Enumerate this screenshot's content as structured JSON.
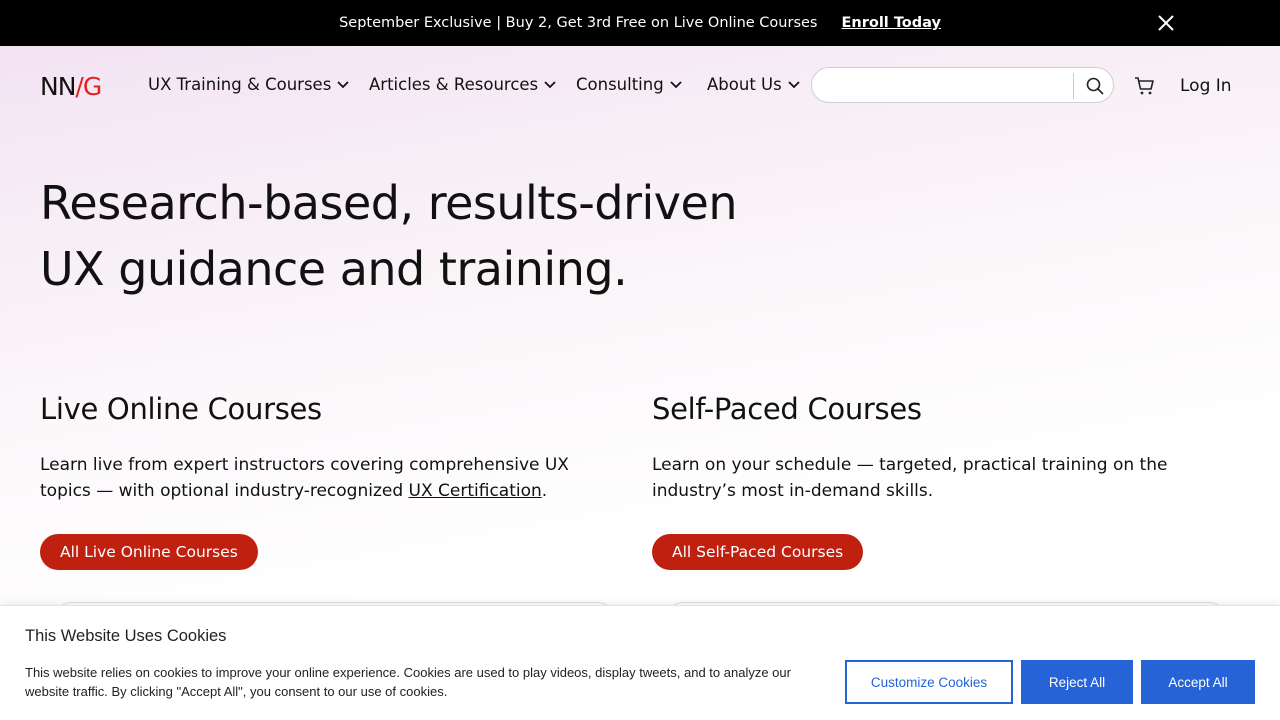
{
  "promo": {
    "text": "September Exclusive | Buy 2, Get 3rd Free on Live Online Courses",
    "link": "Enroll Today"
  },
  "nav": {
    "logo": {
      "part1": "NN",
      "slash": "/",
      "part2": "G"
    },
    "items": [
      {
        "label": "UX Training & Courses"
      },
      {
        "label": "Articles & Resources"
      },
      {
        "label": "Consulting"
      },
      {
        "label": "About Us"
      }
    ],
    "search_value": "",
    "login": "Log In"
  },
  "hero": {
    "line1": "Research-based, results-driven",
    "line2": "UX guidance and training."
  },
  "live": {
    "title": "Live Online Courses",
    "desc_before": "Learn live from expert instructors covering comprehensive UX topics — with optional industry-recognized ",
    "desc_link": "UX Certification",
    "desc_after": ".",
    "button": "All Live Online Courses"
  },
  "selfpaced": {
    "title": "Self-Paced Courses",
    "desc": "Learn on your schedule — targeted, practical training on the industry’s most in-demand skills.",
    "button": "All Self-Paced Courses"
  },
  "cookie": {
    "title": "This Website Uses Cookies",
    "text": "This website relies on cookies to improve your online experience. Cookies are used to play videos, display tweets, and to analyze our website traffic. By clicking \"Accept All\", you consent to our use of cookies.",
    "customize": "Customize Cookies",
    "reject": "Reject All",
    "accept": "Accept All"
  },
  "colors": {
    "accent_red": "#c0200f",
    "cookie_blue": "#2563d6",
    "logo_red": "#e2231a"
  }
}
